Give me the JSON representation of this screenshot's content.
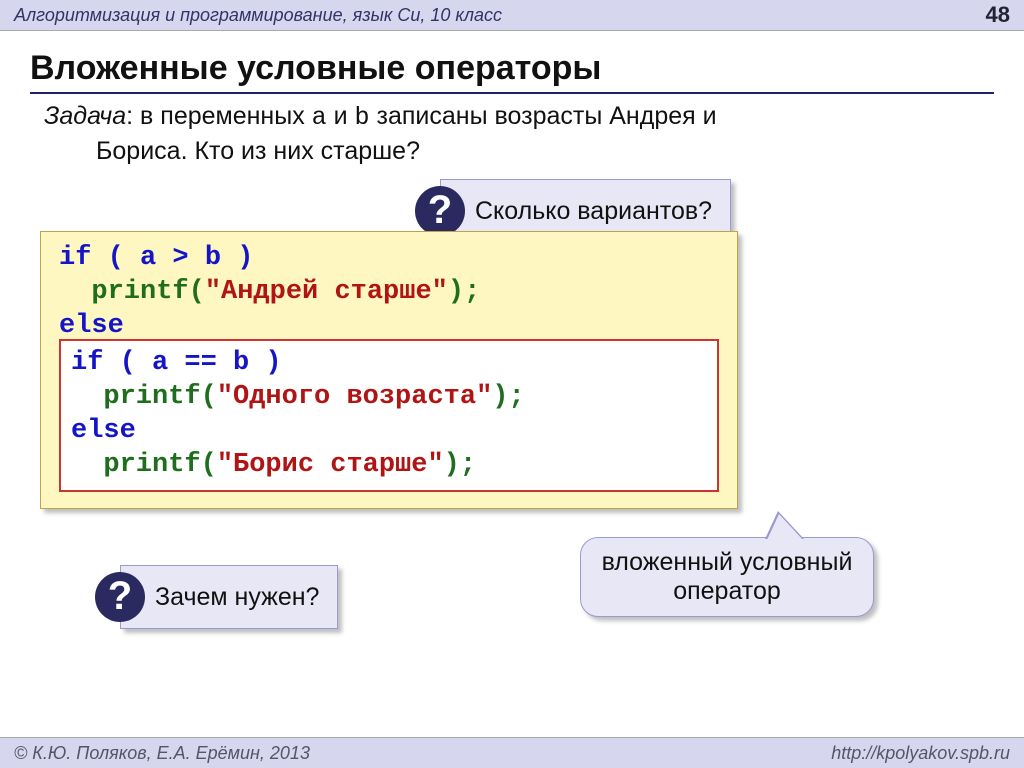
{
  "header": {
    "course": "Алгоритмизация и программирование, язык Си, 10 класс",
    "page": "48"
  },
  "title": "Вложенные условные операторы",
  "task": {
    "label": "Задача",
    "text_before_vars": ": в переменных ",
    "var_a": "a",
    "and": " и ",
    "var_b": "b",
    "text_after_vars": " записаны возрасты Андрея и",
    "line2": "Бориса. Кто из них старше?"
  },
  "callouts": {
    "variants": "Сколько вариантов?",
    "why": "Зачем нужен?",
    "badge": "?"
  },
  "code": {
    "if1": "if",
    "cond1": " ( a > b )",
    "print": "printf",
    "open_p": "(",
    "close_p": ")",
    "semi": ";",
    "str1": "\"Андрей старше\"",
    "else": "else",
    "if2": "if",
    "cond2": " ( a == b )",
    "str2": "\"Одного возраста\"",
    "str3": "\"Борис старше\""
  },
  "speech": "вложенный условный оператор",
  "footer": {
    "left": "К.Ю. Поляков, Е.А. Ерёмин, 2013",
    "right": "http://kpolyakov.spb.ru"
  }
}
